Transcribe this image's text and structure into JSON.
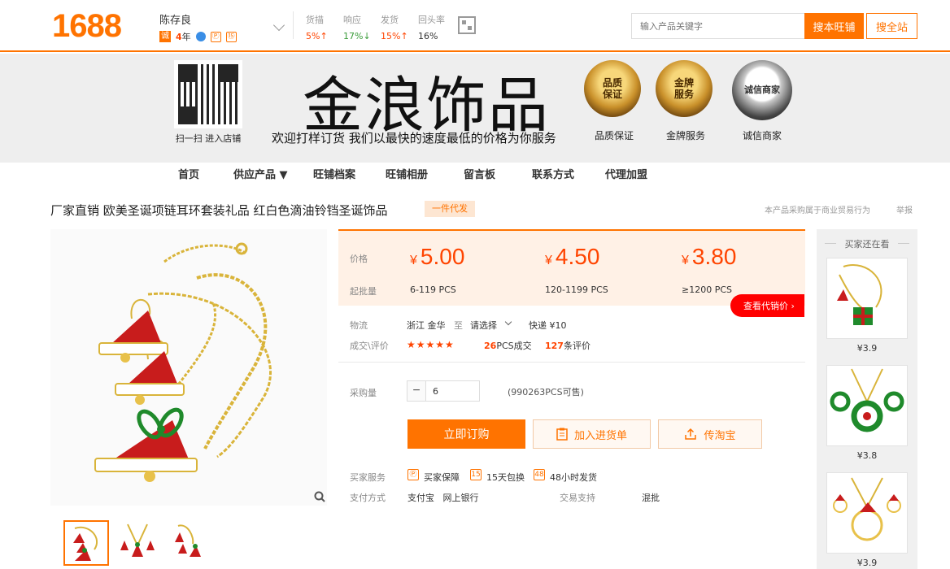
{
  "topbar": {
    "logo": "1688",
    "seller_name": "陈存良",
    "cheng_badge": "诚",
    "years_num": "4",
    "years_unit": "年",
    "badge_bao": "Ⓟ",
    "badge_ling": "⑮",
    "metrics": [
      {
        "label": "货描",
        "value": "5%↑",
        "trend": "up"
      },
      {
        "label": "响应",
        "value": "17%↓",
        "trend": "down"
      },
      {
        "label": "发货",
        "value": "15%↑",
        "trend": "up"
      },
      {
        "label": "回头率",
        "value": "16%",
        "trend": "plain"
      }
    ],
    "search_placeholder": "输入产品关键字",
    "search_shop_label": "搜本旺铺",
    "search_all_label": "搜全站"
  },
  "banner": {
    "qr_caption": "扫一扫 进入店铺",
    "shop_name": "金浪饰品",
    "slogan": "欢迎打样订货 我们以最快的速度最低的价格为你服务",
    "seals": [
      {
        "text": "品质\n保证",
        "caption": "品质保证"
      },
      {
        "text": "金牌\n服务",
        "caption": "金牌服务"
      },
      {
        "text": "诚信商家",
        "caption": "诚信商家"
      }
    ]
  },
  "nav": {
    "items": [
      "首页",
      "供应产品 ▼",
      "旺铺档案",
      "旺铺相册",
      "留言板",
      "联系方式",
      "代理加盟"
    ]
  },
  "product": {
    "title": "厂家直销 欧美圣诞项链耳环套装礼品 红白色滴油铃铛圣诞饰品",
    "dropship_tag": "一件代发",
    "legal_note": "本产品采购属于商业贸易行为",
    "report": "举报"
  },
  "pricing": {
    "price_label": "价格",
    "moq_label": "起批量",
    "currency": "¥",
    "tiers": [
      {
        "price": "5.00",
        "range": "6-119 PCS"
      },
      {
        "price": "4.50",
        "range": "120-1199 PCS"
      },
      {
        "price": "3.80",
        "range": "≥1200 PCS"
      }
    ],
    "dropship_price_btn": "查看代销价 ›"
  },
  "logistics": {
    "label": "物流",
    "origin": "浙江 金华",
    "to": "至",
    "dest": "请选择",
    "express": "快递 ¥10"
  },
  "trades": {
    "label": "成交\\评价",
    "stars": "★★★★★",
    "sold_num": "26",
    "sold_unit": "PCS成交",
    "reviews_num": "127",
    "reviews_unit": "条评价"
  },
  "purchase": {
    "label": "采购量",
    "minus": "−",
    "qty": "6",
    "stock": "(990263PCS可售)",
    "buy_now": "立即订购",
    "add_cart": "加入进货单",
    "send_taobao": "传淘宝"
  },
  "services": {
    "label": "买家服务",
    "items": [
      "买家保障",
      "15天包换",
      "48小时发货"
    ],
    "icons": [
      "Ⓟ",
      "15",
      "48"
    ],
    "pay_label": "支付方式",
    "pay_methods": "支付宝   网上银行",
    "trade_support_label": "交易支持",
    "trade_support": "混批"
  },
  "sidebar": {
    "title": "买家还在看",
    "items": [
      {
        "price": "¥3.9"
      },
      {
        "price": "¥3.8"
      },
      {
        "price": "¥3.9"
      }
    ]
  },
  "colors": {
    "brand_orange": "#ff7300",
    "price_red": "#ff4400",
    "rise_red": "#ff4400",
    "fall_green": "#3a9c3a",
    "dropship_btn_red": "#ff0000"
  }
}
